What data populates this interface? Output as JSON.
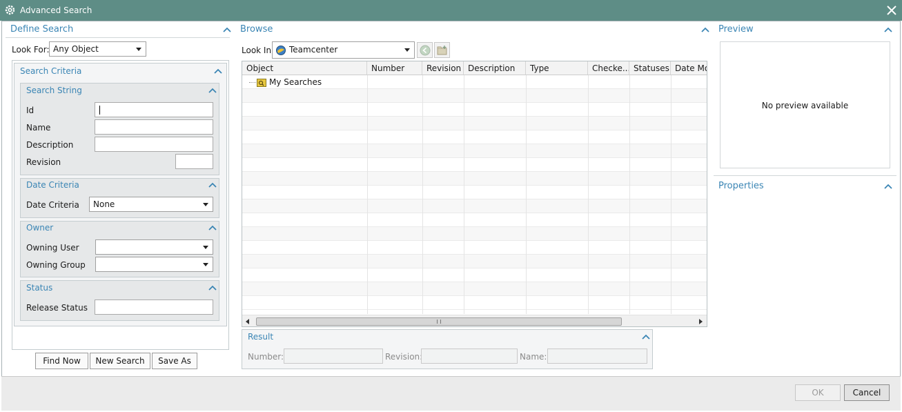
{
  "window": {
    "title": "Advanced Search"
  },
  "define_search": {
    "title": "Define Search",
    "look_for_label": "Look For:",
    "look_for_value": "Any Object",
    "search_criteria_title": "Search Criteria",
    "search_string": {
      "title": "Search String",
      "fields": [
        {
          "label": "Id",
          "value": ""
        },
        {
          "label": "Name",
          "value": ""
        },
        {
          "label": "Description",
          "value": ""
        },
        {
          "label": "Revision",
          "value": ""
        }
      ]
    },
    "date_criteria": {
      "title": "Date Criteria",
      "label": "Date Criteria",
      "value": "None"
    },
    "owner": {
      "title": "Owner",
      "owning_user_label": "Owning User",
      "owning_user_value": "",
      "owning_group_label": "Owning Group",
      "owning_group_value": ""
    },
    "status": {
      "title": "Status",
      "release_status_label": "Release Status",
      "release_status_value": ""
    },
    "buttons": {
      "find_now": "Find Now",
      "new_search": "New Search",
      "save_as": "Save As"
    }
  },
  "browse": {
    "title": "Browse",
    "look_in_label": "Look In",
    "look_in_value": "Teamcenter",
    "columns": [
      "Object",
      "Number",
      "Revision",
      "Description",
      "Type",
      "Checke...",
      "Statuses",
      "Date Mo"
    ],
    "tree_items": [
      "My Searches"
    ]
  },
  "result": {
    "title": "Result",
    "number_label": "Number:",
    "number_value": "",
    "revision_label": "Revision:",
    "revision_value": "",
    "name_label": "Name:",
    "name_value": ""
  },
  "preview": {
    "title": "Preview",
    "empty_text": "No preview available"
  },
  "properties": {
    "title": "Properties"
  },
  "footer": {
    "ok": "OK",
    "cancel": "Cancel"
  },
  "colors": {
    "titlebar": "#5e8d86",
    "accent": "#3a85b4"
  },
  "icons": [
    "gear-icon",
    "close-icon",
    "collapse-chevron-icon",
    "teamcenter-icon",
    "back-icon",
    "folder-new-icon",
    "search-folder-icon"
  ]
}
